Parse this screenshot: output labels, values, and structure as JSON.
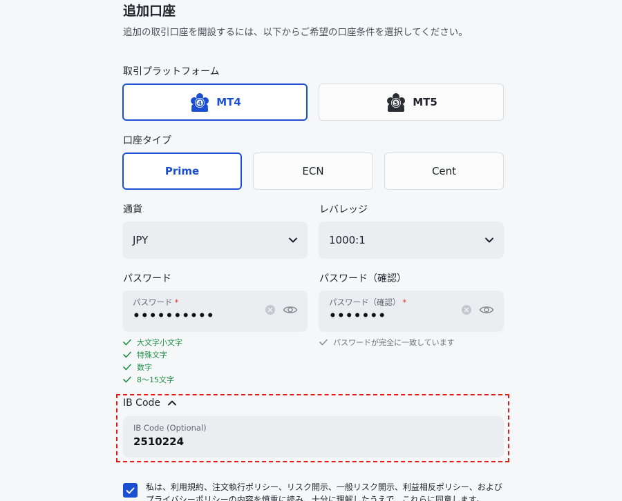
{
  "header": {
    "title": "追加口座",
    "subtitle": "追加の取引口座を開設するには、以下からご希望の口座条件を選択してください。"
  },
  "platform": {
    "label": "取引プラットフォーム",
    "options": [
      {
        "label": "MT4",
        "selected": true,
        "icon": "mt4-logo-icon"
      },
      {
        "label": "MT5",
        "selected": false,
        "icon": "mt5-logo-icon"
      }
    ]
  },
  "account_type": {
    "label": "口座タイプ",
    "options": [
      {
        "label": "Prime",
        "selected": true
      },
      {
        "label": "ECN",
        "selected": false
      },
      {
        "label": "Cent",
        "selected": false
      }
    ]
  },
  "currency": {
    "label": "通貨",
    "value": "JPY"
  },
  "leverage": {
    "label": "レバレッジ",
    "value": "1000:1"
  },
  "password": {
    "label": "パスワード",
    "placeholder": "パスワード",
    "required_mark": "*",
    "value": "••••••••••",
    "rules": [
      "大文字小文字",
      "特殊文字",
      "数字",
      "8〜15文字"
    ]
  },
  "password_confirm": {
    "label": "パスワード（確認）",
    "placeholder": "パスワード（確認）",
    "required_mark": "*",
    "value": "•••••••",
    "match_message": "パスワードが完全に一致しています"
  },
  "ib_code": {
    "toggle_label": "IB Code",
    "placeholder": "IB Code (Optional)",
    "value": "2510224"
  },
  "agreement": {
    "checked": true,
    "text": "私は、利用規約、注文執行ポリシー、リスク開示、一般リスク開示、利益相反ポリシー、およびプライバシーポリシーの内容を慎重に読み、十分に理解したうえで、これらに同意します。"
  },
  "colors": {
    "accent": "#1b4fd1",
    "success": "#1e8f45",
    "required": "#e0332f",
    "highlight": "#e01919"
  }
}
